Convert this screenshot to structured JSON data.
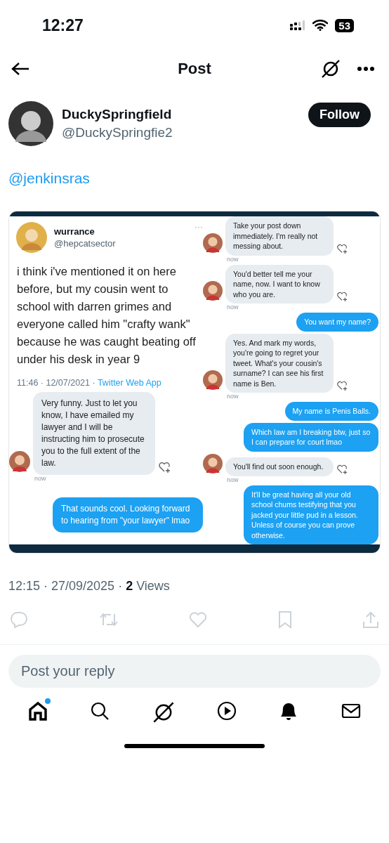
{
  "status_bar": {
    "time": "12:27",
    "battery": "53"
  },
  "header": {
    "title": "Post"
  },
  "author": {
    "name": "DuckySpringfield",
    "handle": "@DuckySpringfie2",
    "follow_label": "Follow"
  },
  "post_text": "@jenkinsras",
  "attached_image": {
    "tweet": {
      "name": "wurrance",
      "handle": "@hepcatsector",
      "more": "···",
      "text": "i think i've mentioned it on here before, but my cousin went to school with darren grimes and everyone called him \"crafty wank\" because he was caught beating off under his desk in year 9",
      "time": "11:46 · 12/07/2021 · ",
      "source": "Twitter Web App"
    },
    "left_messages": [
      {
        "kind": "in",
        "text": "Very funny. Just to let you know, I have emailed my lawyer and I will be instructing him to prosecute you to the full extent of the law.",
        "time": "now"
      },
      {
        "kind": "out",
        "text": "That sounds cool. Looking forward to hearing from \"your lawyer\" lmao"
      }
    ],
    "right_messages": [
      {
        "kind": "in",
        "text": "Take your post down immediately. I'm really not messing about.",
        "time": "now"
      },
      {
        "kind": "in",
        "text": "You'd better tell me your name, now. I want to know who you are.",
        "time": "now"
      },
      {
        "kind": "out",
        "text": "You want my name?"
      },
      {
        "kind": "in",
        "text": "Yes. And mark my words, you're going to regret your tweet. What's your cousin's surname? I can see his first name is Ben.",
        "time": "now"
      },
      {
        "kind": "out",
        "text": "My name is Penis Balls."
      },
      {
        "kind": "out",
        "text": "Which law am I breaking btw, just so I can prepare for court lmao"
      },
      {
        "kind": "in",
        "text": "You'll find out soon enough.",
        "time": "now"
      },
      {
        "kind": "out",
        "text": "It'll be great having all your old school chums testifying that you jacked your little pud in a lesson. Unless of course you can prove otherwise."
      }
    ]
  },
  "post_meta": {
    "time": "12:15 · 27/09/2025 · ",
    "views_count": "2",
    "views_label": " Views"
  },
  "reply": {
    "placeholder": "Post your reply"
  },
  "bottom_nav": [
    {
      "kind": "home",
      "selected": true,
      "badge": true
    },
    {
      "kind": "search",
      "selected": false,
      "badge": false
    },
    {
      "kind": "grok",
      "selected": false,
      "badge": false
    },
    {
      "kind": "video",
      "selected": false,
      "badge": false
    },
    {
      "kind": "notifications",
      "selected": false,
      "badge": false
    },
    {
      "kind": "messages",
      "selected": false,
      "badge": false
    }
  ]
}
